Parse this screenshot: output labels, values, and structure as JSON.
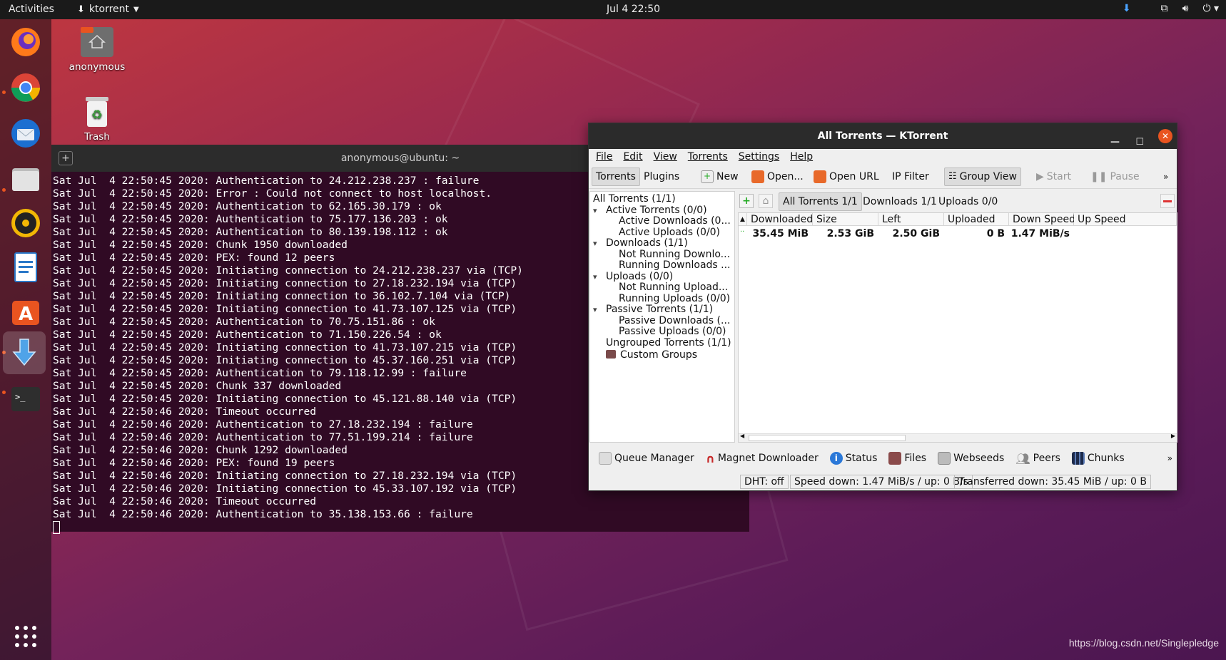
{
  "topbar": {
    "activities": "Activities",
    "app_name": "ktorrent",
    "clock": "Jul 4  22:50"
  },
  "desktop": {
    "home_label": "anonymous",
    "trash_label": "Trash"
  },
  "dock": {
    "items": [
      "firefox-icon",
      "chrome-icon",
      "thunderbird-icon",
      "files-icon",
      "rhythmbox-icon",
      "writer-icon",
      "software-icon",
      "ktorrent-icon",
      "terminal-icon"
    ]
  },
  "terminal": {
    "title": "anonymous@ubuntu: ~",
    "lines": [
      "Sat Jul  4 22:50:45 2020: Authentication to 24.212.238.237 : failure",
      "Sat Jul  4 22:50:45 2020: Error : Could not connect to host localhost.",
      "Sat Jul  4 22:50:45 2020: Authentication to 62.165.30.179 : ok",
      "Sat Jul  4 22:50:45 2020: Authentication to 75.177.136.203 : ok",
      "Sat Jul  4 22:50:45 2020: Authentication to 80.139.198.112 : ok",
      "Sat Jul  4 22:50:45 2020: Chunk 1950 downloaded",
      "Sat Jul  4 22:50:45 2020: PEX: found 12 peers",
      "Sat Jul  4 22:50:45 2020: Initiating connection to 24.212.238.237 via (TCP)",
      "Sat Jul  4 22:50:45 2020: Initiating connection to 27.18.232.194 via (TCP)",
      "Sat Jul  4 22:50:45 2020: Initiating connection to 36.102.7.104 via (TCP)",
      "Sat Jul  4 22:50:45 2020: Initiating connection to 41.73.107.125 via (TCP)",
      "Sat Jul  4 22:50:45 2020: Authentication to 70.75.151.86 : ok",
      "Sat Jul  4 22:50:45 2020: Authentication to 71.150.226.54 : ok",
      "Sat Jul  4 22:50:45 2020: Initiating connection to 41.73.107.215 via (TCP)",
      "Sat Jul  4 22:50:45 2020: Initiating connection to 45.37.160.251 via (TCP)",
      "Sat Jul  4 22:50:45 2020: Authentication to 79.118.12.99 : failure",
      "Sat Jul  4 22:50:45 2020: Chunk 337 downloaded",
      "Sat Jul  4 22:50:45 2020: Initiating connection to 45.121.88.140 via (TCP)",
      "Sat Jul  4 22:50:46 2020: Timeout occurred",
      "Sat Jul  4 22:50:46 2020: Authentication to 27.18.232.194 : failure",
      "Sat Jul  4 22:50:46 2020: Authentication to 77.51.199.214 : failure",
      "Sat Jul  4 22:50:46 2020: Chunk 1292 downloaded",
      "Sat Jul  4 22:50:46 2020: PEX: found 19 peers",
      "Sat Jul  4 22:50:46 2020: Initiating connection to 27.18.232.194 via (TCP)",
      "Sat Jul  4 22:50:46 2020: Initiating connection to 45.33.107.192 via (TCP)",
      "Sat Jul  4 22:50:46 2020: Timeout occurred",
      "Sat Jul  4 22:50:46 2020: Authentication to 35.138.153.66 : failure"
    ]
  },
  "ktorrent": {
    "title": "All Torrents — KTorrent",
    "menu": [
      "File",
      "Edit",
      "View",
      "Torrents",
      "Settings",
      "Help"
    ],
    "toolbar": {
      "torrents": "Torrents",
      "plugins": "Plugins",
      "new": "New",
      "open": "Open...",
      "open_url": "Open URL",
      "ip_filter": "IP Filter",
      "group_view": "Group View",
      "start": "Start",
      "pause": "Pause",
      "more": "»"
    },
    "groups": [
      {
        "label": "All Torrents (1/1)",
        "indent": 0,
        "arrow": ""
      },
      {
        "label": "Active Torrents (0/0)",
        "indent": 1,
        "arrow": "▾"
      },
      {
        "label": "Active Downloads (0...",
        "indent": 2,
        "arrow": ""
      },
      {
        "label": "Active Uploads (0/0)",
        "indent": 2,
        "arrow": ""
      },
      {
        "label": "Downloads (1/1)",
        "indent": 1,
        "arrow": "▾"
      },
      {
        "label": "Not Running Downlo...",
        "indent": 2,
        "arrow": ""
      },
      {
        "label": "Running Downloads ...",
        "indent": 2,
        "arrow": ""
      },
      {
        "label": "Uploads (0/0)",
        "indent": 1,
        "arrow": "▾"
      },
      {
        "label": "Not Running Upload...",
        "indent": 2,
        "arrow": ""
      },
      {
        "label": "Running Uploads (0/0)",
        "indent": 2,
        "arrow": ""
      },
      {
        "label": "Passive Torrents (1/1)",
        "indent": 1,
        "arrow": "▾"
      },
      {
        "label": "Passive Downloads (...",
        "indent": 2,
        "arrow": ""
      },
      {
        "label": "Passive Uploads (0/0)",
        "indent": 2,
        "arrow": ""
      },
      {
        "label": "Ungrouped Torrents (1/1)",
        "indent": 1,
        "arrow": ""
      },
      {
        "label": "Custom Groups",
        "indent": 1,
        "arrow": ""
      }
    ],
    "view_tabs": {
      "all": "All Torrents 1/1",
      "downloads": "Downloads 1/1",
      "uploads": "Uploads 0/0"
    },
    "columns": [
      "Downloaded",
      "Size",
      "Left",
      "Uploaded",
      "Down Speed",
      "Up Speed"
    ],
    "row": {
      "downloaded": "35.45 MiB",
      "size": "2.53 GiB",
      "left": "2.50 GiB",
      "uploaded": "0 B",
      "down_speed": "1.47 MiB/s",
      "up_speed": ""
    },
    "bottom_tabs": [
      "Queue Manager",
      "Magnet Downloader",
      "Status",
      "Files",
      "Webseeds",
      "Peers",
      "Chunks"
    ],
    "status": {
      "dht": "DHT: off",
      "speed": "Speed down: 1.47 MiB/s / up: 0 B/s",
      "transferred": "Transferred down: 35.45 MiB / up: 0 B"
    }
  },
  "watermark": "https://blog.csdn.net/Singlepledge",
  "colors": {
    "accent": "#e95420",
    "terminal_bg": "#300a24"
  }
}
